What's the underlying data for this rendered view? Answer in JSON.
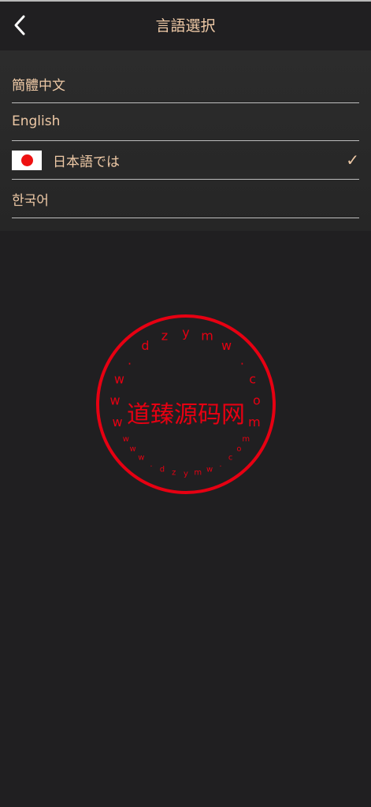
{
  "header": {
    "title": "言語選択",
    "back_icon": "chevron-left-icon"
  },
  "languages": [
    {
      "label": "簡體中文",
      "selected": false
    },
    {
      "label": "English",
      "selected": false
    },
    {
      "label": "日本語では",
      "selected": true,
      "flag": "japan-flag-icon"
    },
    {
      "label": "한국어",
      "selected": false
    }
  ],
  "selected_mark": "✓",
  "watermark": {
    "center_text": "道臻源码网",
    "ring_text": "www.dzymw.com",
    "color": "#e60012"
  },
  "colors": {
    "accent": "#eec9a6",
    "background": "#201f21",
    "list_background": "#2a2a2a"
  }
}
